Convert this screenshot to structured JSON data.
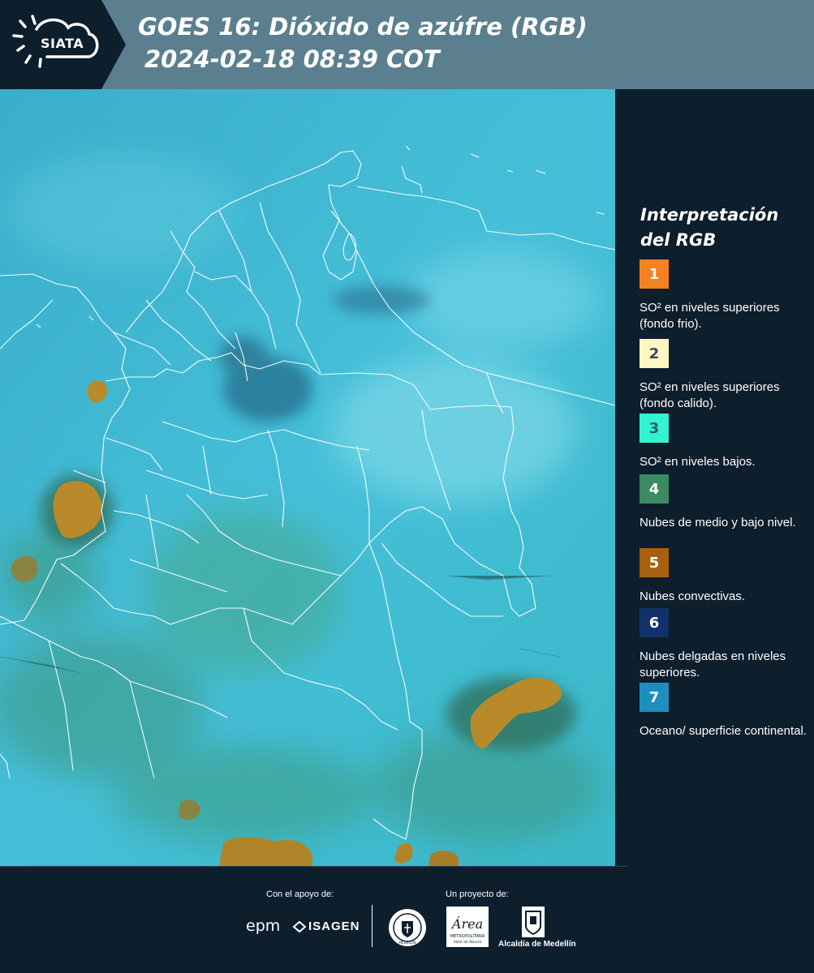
{
  "header": {
    "logo_text": "SIATA",
    "title_line1": "GOES 16: Dióxido de azúfre (RGB)",
    "title_line2": "2024-02-18 08:39 COT"
  },
  "legend": {
    "title_line1": "Interpretación",
    "title_line2": "del RGB",
    "items": [
      {
        "number": "1",
        "color": "#f58220",
        "number_color": "#ffffff",
        "label": "SO² en niveles superiores (fondo frio)."
      },
      {
        "number": "2",
        "color": "#fff6c3",
        "number_color": "#3a4a58",
        "label": "SO² en niveles superiores (fondo calido)."
      },
      {
        "number": "3",
        "color": "#35f2d2",
        "number_color": "#2e5d66",
        "label": "SO² en niveles bajos."
      },
      {
        "number": "4",
        "color": "#3b8a62",
        "number_color": "#ffffff",
        "label": "Nubes de medio y bajo nivel."
      },
      {
        "number": "5",
        "color": "#a8600e",
        "number_color": "#ffffff",
        "label": "Nubes convectivas."
      },
      {
        "number": "6",
        "color": "#12306a",
        "number_color": "#ffffff",
        "label": "Nubes delgadas en niveles superiores."
      },
      {
        "number": "7",
        "color": "#1c8fbf",
        "number_color": "#ffffff",
        "label": "Oceano/ superficie continental."
      }
    ]
  },
  "footer": {
    "support_label": "Con el apoyo de:",
    "project_label": "Un proyecto de:",
    "epm": "epm",
    "isagen": "ISAGEN",
    "area_text": "Área",
    "area_sub": "METROPOLITANA",
    "area_sub2": "Valle de Aburrá",
    "seal_text": "MEDELLÍN",
    "alcaldia": "Alcaldía de Medellín"
  }
}
